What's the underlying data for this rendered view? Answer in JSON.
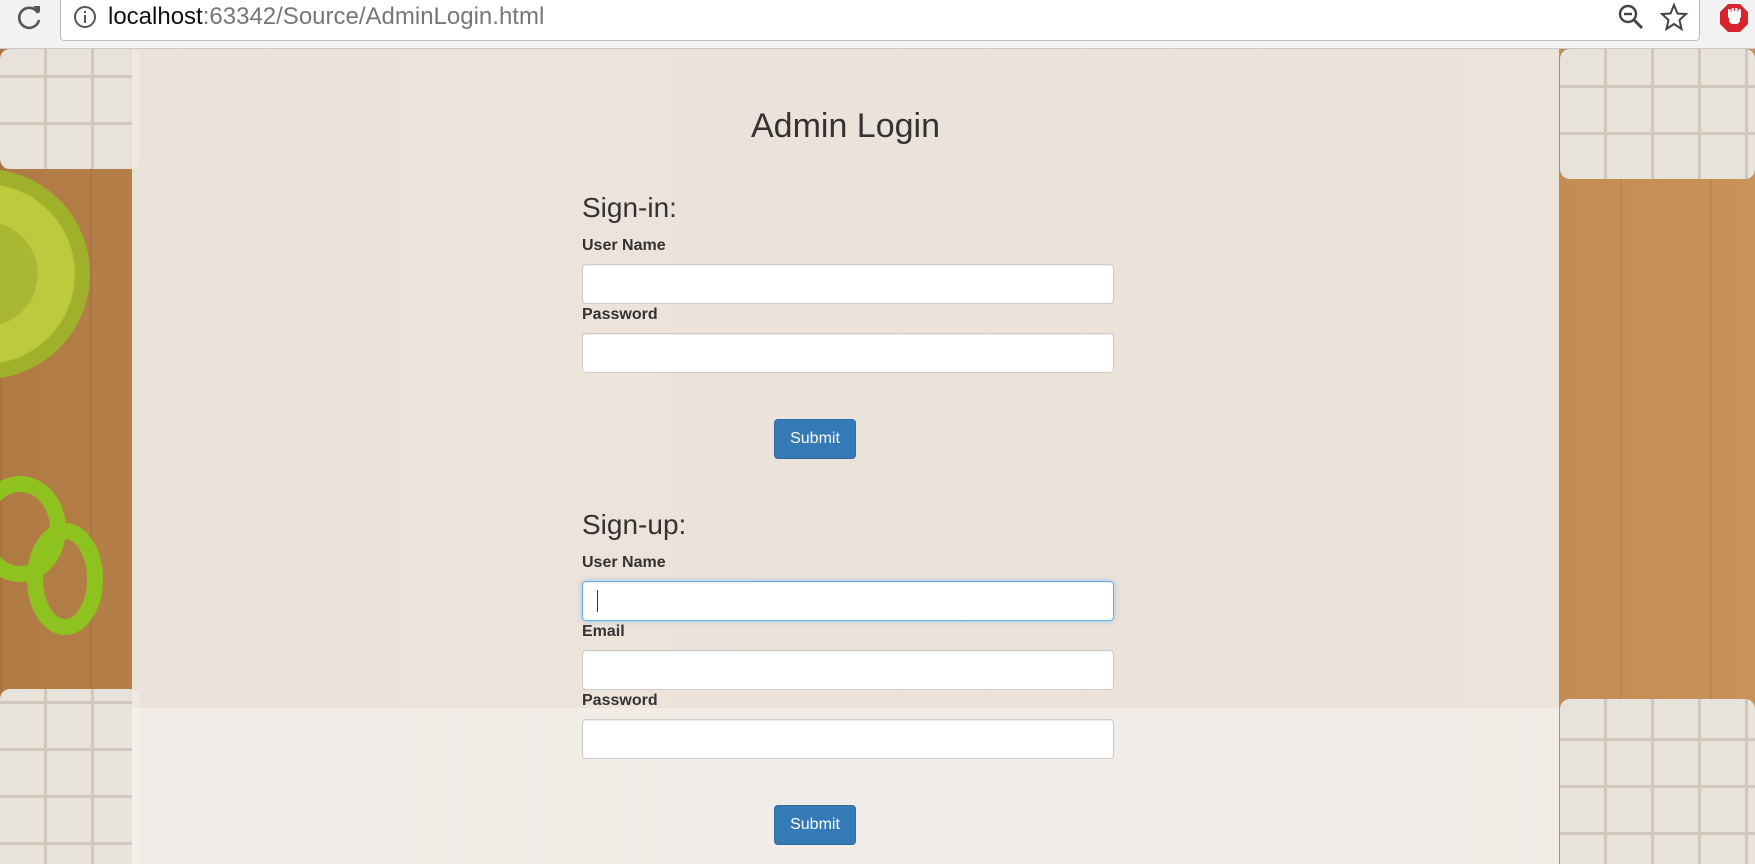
{
  "browser": {
    "url_host": "localhost",
    "url_path": ":63342/Source/AdminLogin.html"
  },
  "page": {
    "title": "Admin Login"
  },
  "signin": {
    "heading": "Sign-in:",
    "username_label": "User Name",
    "username_value": "",
    "password_label": "Password",
    "password_value": "",
    "submit_label": "Submit"
  },
  "signup": {
    "heading": "Sign-up:",
    "username_label": "User Name",
    "username_value": "",
    "email_label": "Email",
    "email_value": "",
    "password_label": "Password",
    "password_value": "",
    "submit_label": "Submit"
  },
  "colors": {
    "primary_button": "#337ab7",
    "focus_border": "#66afe9",
    "text": "#333333"
  },
  "icons": [
    "reload-icon",
    "info-icon",
    "zoom-out-icon",
    "bookmark-star-icon",
    "extension-icon"
  ]
}
